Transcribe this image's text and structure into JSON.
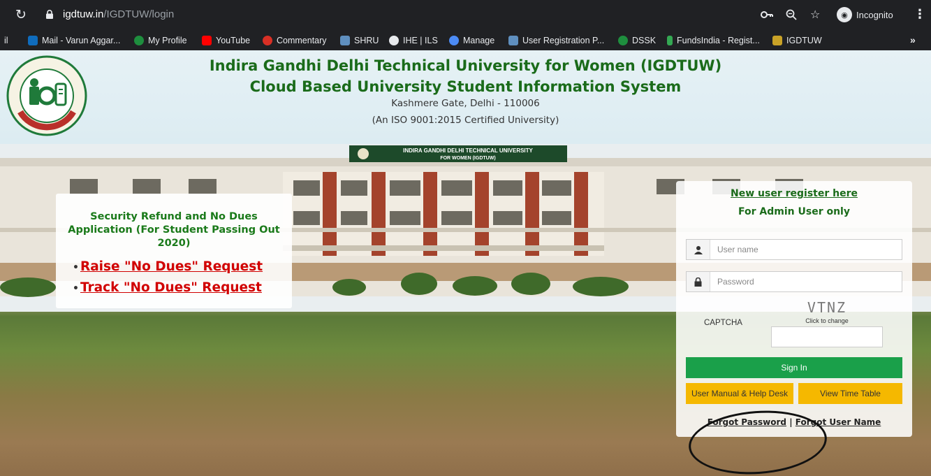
{
  "browser": {
    "url_host": "igdtuw.in",
    "url_path": "/IGDTUW/login",
    "incognito_label": "Incognito"
  },
  "bookmarks": [
    {
      "label": "il",
      "color": "#202124"
    },
    {
      "label": "Mail - Varun Aggar...",
      "color": "#0f6cbd"
    },
    {
      "label": "My Profile",
      "color": "#1e8e3e"
    },
    {
      "label": "YouTube",
      "color": "#ff0000"
    },
    {
      "label": "Commentary",
      "color": "#d93025"
    },
    {
      "label": "SHRU",
      "color": "#5f8fbf"
    },
    {
      "label": "IHE | ILS",
      "color": "#e8eaed"
    },
    {
      "label": "Manage",
      "color": "#4c8bf5"
    },
    {
      "label": "User Registration P...",
      "color": "#5f8fbf"
    },
    {
      "label": "DSSK",
      "color": "#1e8e3e"
    },
    {
      "label": "FundsIndia - Regist...",
      "color": "#34a853"
    },
    {
      "label": "IGDTUW",
      "color": "#c9a227"
    }
  ],
  "header": {
    "title_line1": "Indira Gandhi Delhi Technical University for Women (IGDTUW)",
    "title_line2": "Cloud Based University Student Information System",
    "address": "Kashmere Gate, Delhi - 110006",
    "certification": "(An ISO 9001:2015 Certified University)",
    "building_sign_line1": "INDIRA GANDHI DELHI TECHNICAL UNIVERSITY",
    "building_sign_line2": "FOR WOMEN (IGDTUW)"
  },
  "notice": {
    "title": "Security Refund and No Dues Application (For Student Passing Out 2020)",
    "link_raise": "Raise \"No Dues\" Request",
    "link_track": "Track \"No Dues\" Request"
  },
  "login": {
    "register_link": "New user register here",
    "admin_note": "For Admin User only",
    "username_placeholder": "User name",
    "password_placeholder": "Password",
    "captcha_label": "CAPTCHA",
    "captcha_text": "VTNZ",
    "captcha_hint": "Click to change",
    "signin_label": "Sign In",
    "help_label": "User Manual & Help Desk",
    "timetable_label": "View Time Table",
    "forgot_password": "Forgot Password",
    "forgot_separator": "|",
    "forgot_username": "Forgot User Name"
  },
  "colors": {
    "title_green": "#1a6b1a",
    "signin_green": "#1aa04a",
    "button_yellow": "#f5b800",
    "link_red": "#d10000"
  }
}
